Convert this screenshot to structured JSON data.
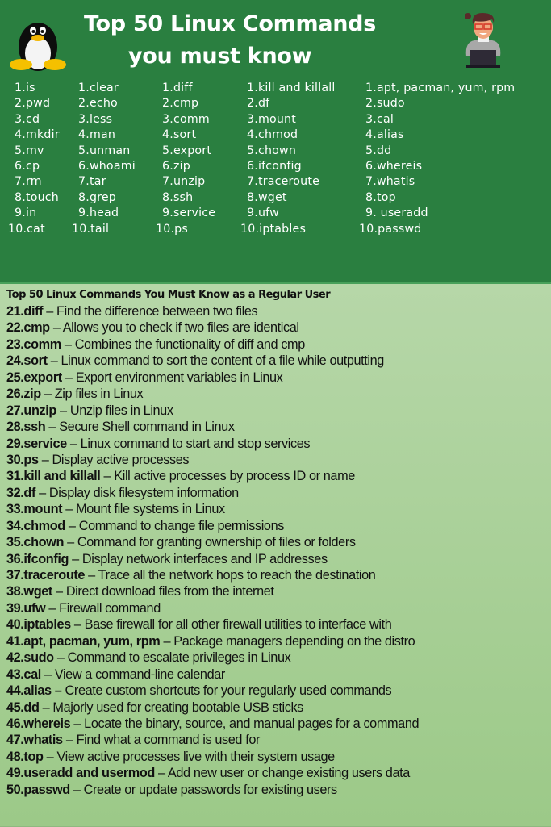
{
  "header": {
    "title_line1": "Top 50 Linux Commands",
    "title_line2": "you must know",
    "left_icon": "tux-penguin-icon",
    "right_icon": "developer-at-laptop-icon",
    "colors": {
      "header_bg": "#2a7f40",
      "body_bg": "#a3cc8d",
      "text": "#ffffff"
    }
  },
  "columns": [
    {
      "items": [
        {
          "num": "1.",
          "cmd": "is"
        },
        {
          "num": "2.",
          "cmd": "pwd"
        },
        {
          "num": "3.",
          "cmd": "cd"
        },
        {
          "num": "4.",
          "cmd": "mkdir"
        },
        {
          "num": "5.",
          "cmd": "mv"
        },
        {
          "num": "6.",
          "cmd": "cp"
        },
        {
          "num": "7.",
          "cmd": "rm"
        },
        {
          "num": "8.",
          "cmd": "touch"
        },
        {
          "num": "9.",
          "cmd": "in"
        },
        {
          "num": "10.",
          "cmd": "cat"
        }
      ]
    },
    {
      "items": [
        {
          "num": "1.",
          "cmd": "clear"
        },
        {
          "num": "2.",
          "cmd": "echo"
        },
        {
          "num": "3.",
          "cmd": "less"
        },
        {
          "num": "4.",
          "cmd": "man"
        },
        {
          "num": "5.",
          "cmd": "unman"
        },
        {
          "num": "6.",
          "cmd": "whoami"
        },
        {
          "num": "7.",
          "cmd": "tar"
        },
        {
          "num": "8.",
          "cmd": "grep"
        },
        {
          "num": "9.",
          "cmd": "head"
        },
        {
          "num": "10.",
          "cmd": "tail"
        }
      ]
    },
    {
      "items": [
        {
          "num": "1.",
          "cmd": "diff"
        },
        {
          "num": "2.",
          "cmd": "cmp"
        },
        {
          "num": "3.",
          "cmd": "comm"
        },
        {
          "num": "4.",
          "cmd": "sort"
        },
        {
          "num": "5.",
          "cmd": "export"
        },
        {
          "num": "6.",
          "cmd": "zip"
        },
        {
          "num": "7.",
          "cmd": "unzip"
        },
        {
          "num": "8.",
          "cmd": "ssh"
        },
        {
          "num": "9.",
          "cmd": "service"
        },
        {
          "num": "10.",
          "cmd": "ps"
        }
      ]
    },
    {
      "items": [
        {
          "num": "1.",
          "cmd": "kill and killall"
        },
        {
          "num": "2.",
          "cmd": "df"
        },
        {
          "num": "3.",
          "cmd": "mount"
        },
        {
          "num": "4.",
          "cmd": "chmod"
        },
        {
          "num": "5.",
          "cmd": "chown"
        },
        {
          "num": "6.",
          "cmd": "ifconfig"
        },
        {
          "num": "7.",
          "cmd": "traceroute"
        },
        {
          "num": "8.",
          "cmd": "wget"
        },
        {
          "num": "9.",
          "cmd": "ufw"
        },
        {
          "num": "10.",
          "cmd": "iptables"
        }
      ]
    },
    {
      "items": [
        {
          "num": "1.",
          "cmd": "apt, pacman, yum, rpm"
        },
        {
          "num": "2.",
          "cmd": "sudo"
        },
        {
          "num": "3.",
          "cmd": "cal"
        },
        {
          "num": "4.",
          "cmd": "alias"
        },
        {
          "num": "5.",
          "cmd": "dd"
        },
        {
          "num": "6.",
          "cmd": "whereis"
        },
        {
          "num": "7.",
          "cmd": "whatis"
        },
        {
          "num": "8.",
          "cmd": "top"
        },
        {
          "num": "9.",
          "cmd": " useradd"
        },
        {
          "num": "10.",
          "cmd": "passwd"
        }
      ]
    }
  ],
  "details": {
    "title": "Top 50 Linux Commands You Must Know as a Regular User",
    "items": [
      {
        "cmd": "21.diff",
        "desc": " – Find the difference between two files"
      },
      {
        "cmd": "22.cmp",
        "desc": " – Allows you to check if two files are identical"
      },
      {
        "cmd": "23.comm",
        "desc": " – Combines the functionality of diff and cmp"
      },
      {
        "cmd": "24.sort",
        "desc": " – Linux command to sort the content of a file while outputting"
      },
      {
        "cmd": "25.export",
        "desc": " – Export environment variables in Linux"
      },
      {
        "cmd": "26.zip",
        "desc": " – Zip files in Linux"
      },
      {
        "cmd": "27.unzip",
        "desc": " – Unzip files in Linux"
      },
      {
        "cmd": "28.ssh",
        "desc": " – Secure Shell command in Linux"
      },
      {
        "cmd": "29.service",
        "desc": " – Linux command to start and stop services"
      },
      {
        "cmd": "30.ps",
        "desc": " – Display active processes"
      },
      {
        "cmd": "31.kill and killall",
        "desc": " – Kill active processes by process ID or name"
      },
      {
        "cmd": "32.df",
        "desc": " – Display disk filesystem information"
      },
      {
        "cmd": "33.mount",
        "desc": " – Mount file systems in Linux"
      },
      {
        "cmd": "34.chmod",
        "desc": " – Command to change file permissions"
      },
      {
        "cmd": "35.chown",
        "desc": " – Command for granting ownership of files or folders"
      },
      {
        "cmd": "36.ifconfig",
        "desc": " – Display network interfaces and IP addresses"
      },
      {
        "cmd": "37.traceroute",
        "desc": " – Trace all the network hops to reach the destination"
      },
      {
        "cmd": "38.wget",
        "desc": " – Direct download files from the internet"
      },
      {
        "cmd": "39.ufw",
        "desc": " – Firewall command"
      },
      {
        "cmd": "40.iptables",
        "desc": " – Base firewall for all other firewall utilities to interface with"
      },
      {
        "cmd": "41.apt, pacman, yum, rpm",
        "desc": " – Package managers depending on the distro"
      },
      {
        "cmd": "42.sudo",
        "desc": " – Command to escalate privileges in Linux"
      },
      {
        "cmd": "43.cal",
        "desc": " – View a command-line calendar"
      },
      {
        "cmd": "44.alias –",
        "desc": " Create custom shortcuts for your regularly used commands"
      },
      {
        "cmd": "45.dd",
        "desc": " – Majorly used for creating bootable USB sticks"
      },
      {
        "cmd": "46.whereis",
        "desc": " – Locate the binary, source, and manual pages for a command"
      },
      {
        "cmd": "47.whatis",
        "desc": " – Find what a command is used for"
      },
      {
        "cmd": "48.top",
        "desc": " – View active processes live with their system usage"
      },
      {
        "cmd": "49.useradd and usermod",
        "desc": " – Add new user or change existing users data"
      },
      {
        "cmd": "50.passwd",
        "desc": " – Create or update passwords for existing users"
      }
    ]
  }
}
